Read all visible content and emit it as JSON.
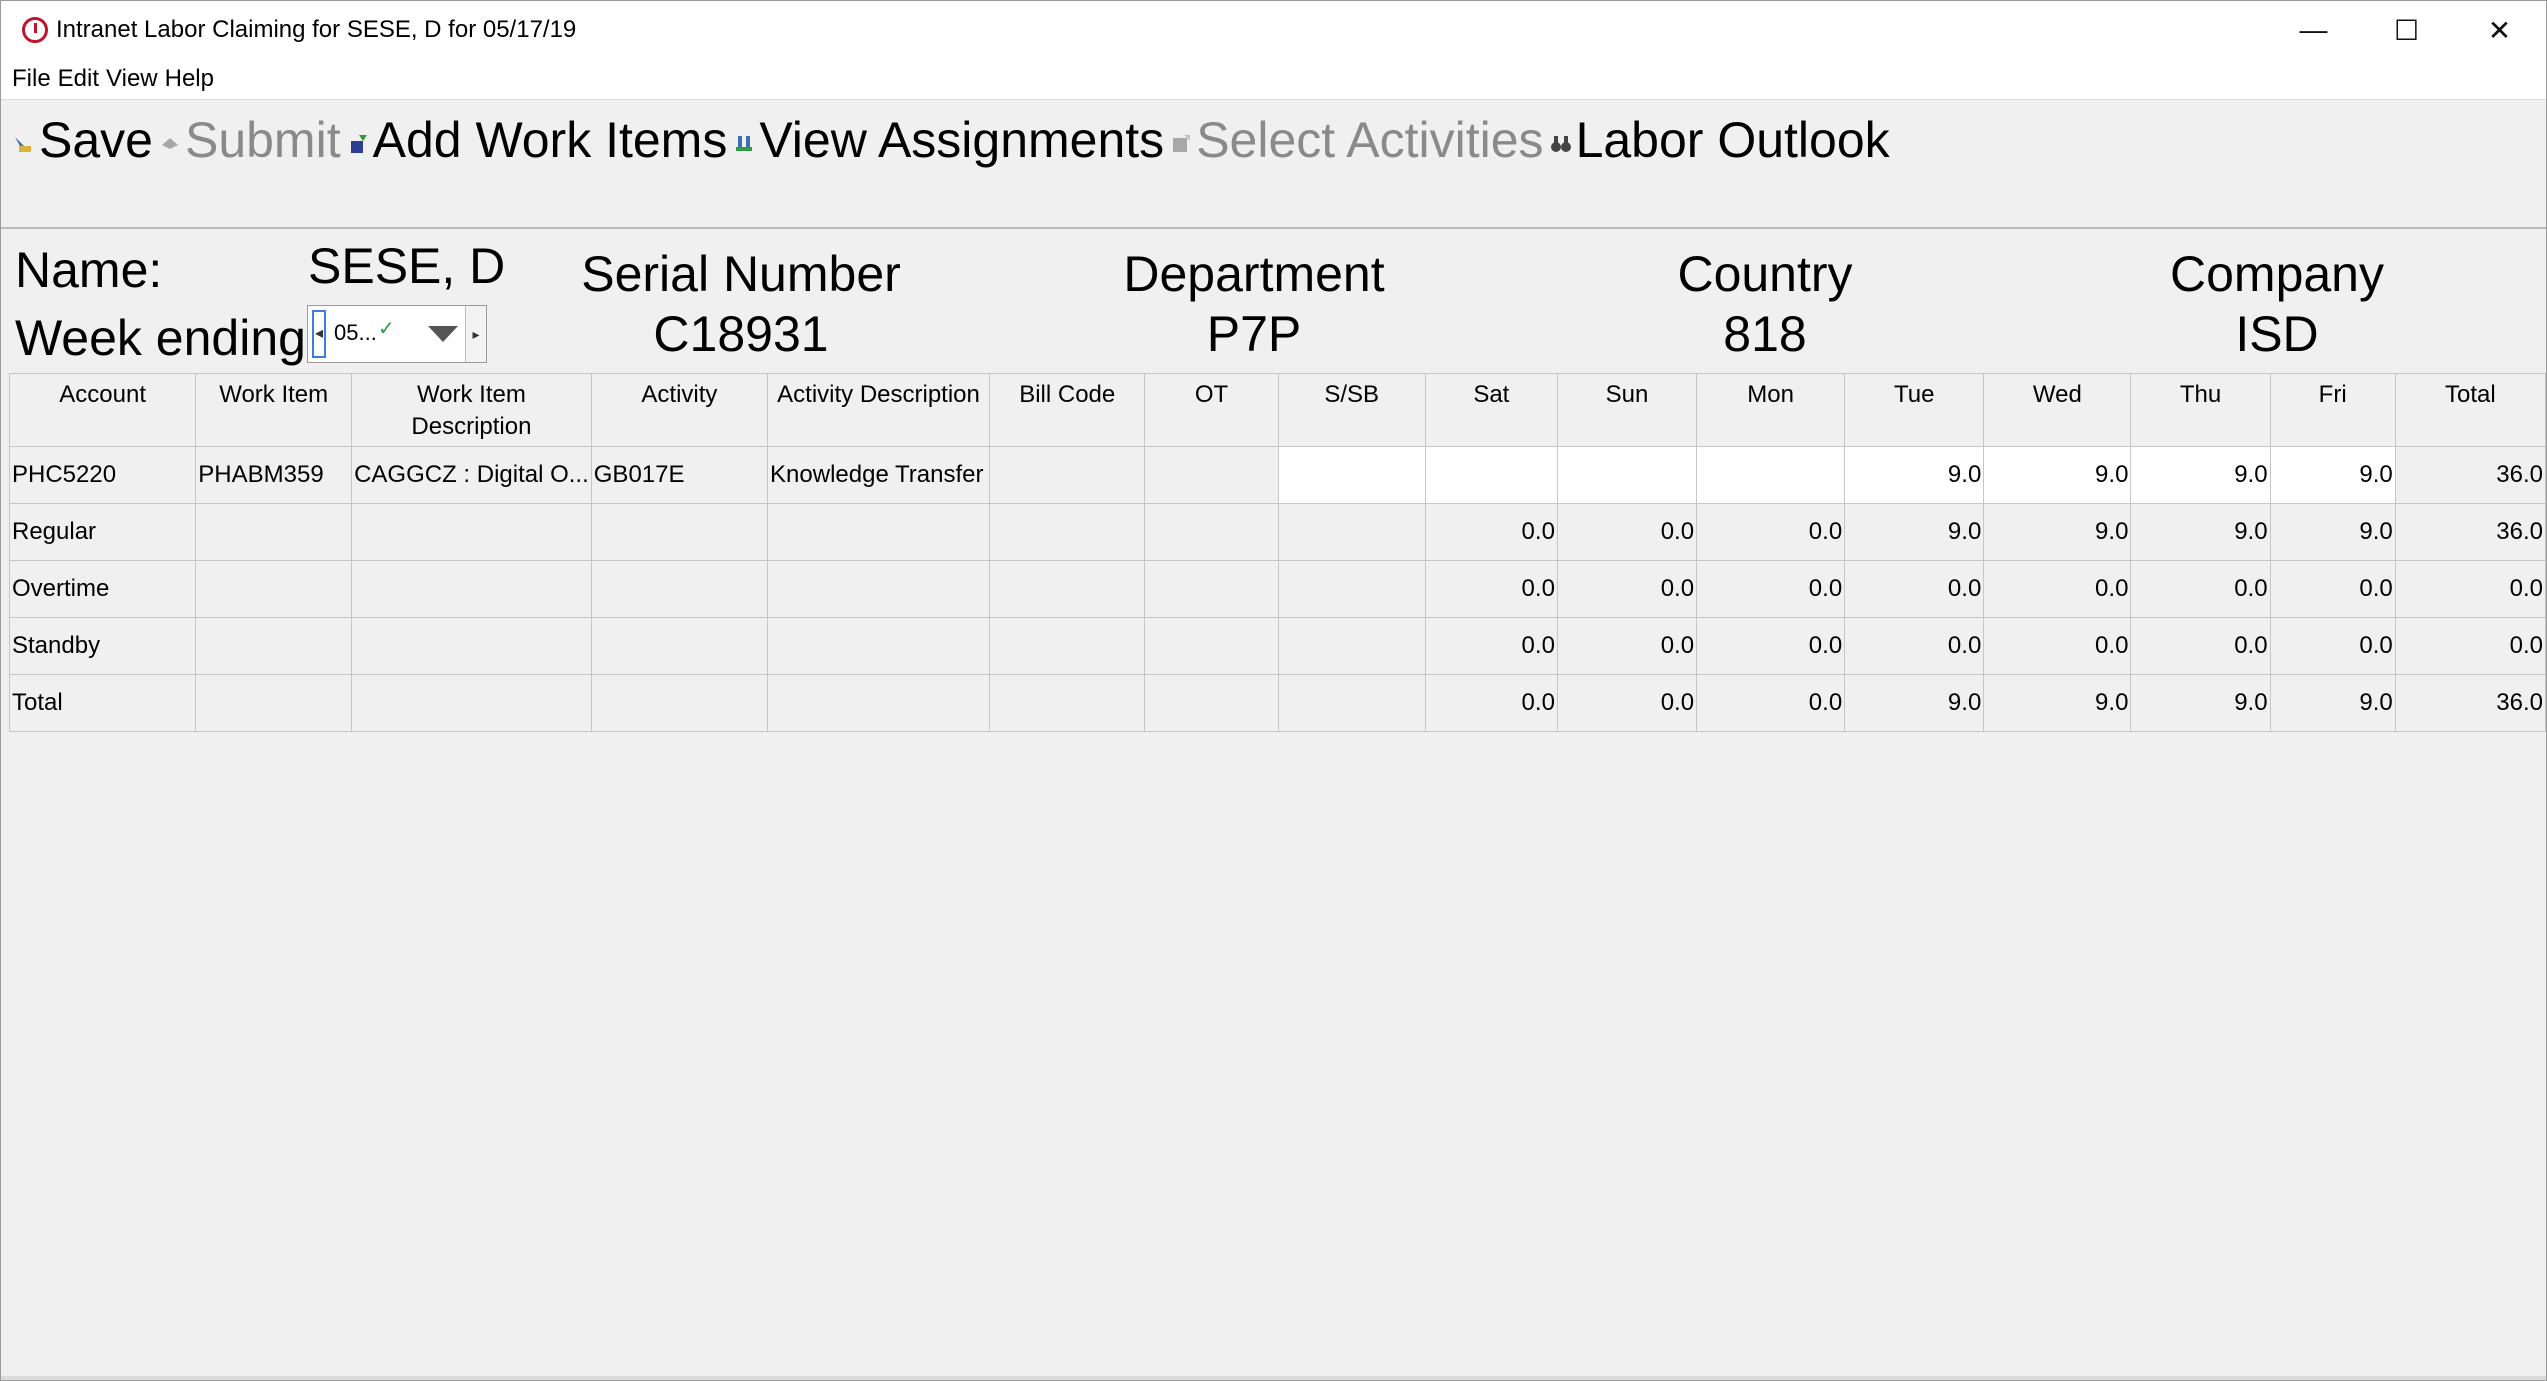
{
  "window": {
    "title": "Intranet Labor Claiming for SESE, D for 05/17/19",
    "controls": {
      "minimize": "—",
      "maximize": "☐",
      "close": "✕"
    }
  },
  "menu": {
    "items": [
      "File",
      "Edit",
      "View",
      "Help"
    ]
  },
  "toolbar": {
    "buttons": [
      {
        "label": "Save",
        "enabled": true,
        "icon": "save-icon"
      },
      {
        "label": "Submit",
        "enabled": false,
        "icon": "submit-icon"
      },
      {
        "label": "Add Work Items",
        "enabled": true,
        "icon": "add-icon"
      },
      {
        "label": "View Assignments",
        "enabled": true,
        "icon": "assignments-icon"
      },
      {
        "label": "Select Activities",
        "enabled": false,
        "icon": "activities-icon"
      },
      {
        "label": "Labor Outlook",
        "enabled": true,
        "icon": "binoculars-icon"
      }
    ]
  },
  "header": {
    "name_label": "Name:",
    "name_value": "SESE, D",
    "week_label": "Week ending:",
    "week_value": "05...",
    "serial_label": "Serial Number",
    "serial_value": "C18931",
    "department_label": "Department",
    "department_value": "P7P",
    "country_label": "Country",
    "country_value": "818",
    "company_label": "Company",
    "company_value": "ISD"
  },
  "grid": {
    "columns": [
      "Account",
      "Work Item",
      "Work Item Description",
      "Activity",
      "Activity Description",
      "Bill Code",
      "OT",
      "S/SB",
      "Sat",
      "Sun",
      "Mon",
      "Tue",
      "Wed",
      "Thu",
      "Fri",
      "Total"
    ],
    "rows": [
      [
        "PHC5220",
        "PHABM359",
        "CAGGCZ : Digital O...",
        "GB017E",
        "Knowledge Transfer",
        "",
        "",
        "",
        "",
        "",
        "",
        "9.0",
        "9.0",
        "9.0",
        "9.0",
        "36.0"
      ],
      [
        "Regular",
        "",
        "",
        "",
        "",
        "",
        "",
        "",
        "0.0",
        "0.0",
        "0.0",
        "9.0",
        "9.0",
        "9.0",
        "9.0",
        "36.0"
      ],
      [
        "Overtime",
        "",
        "",
        "",
        "",
        "",
        "",
        "",
        "0.0",
        "0.0",
        "0.0",
        "0.0",
        "0.0",
        "0.0",
        "0.0",
        "0.0"
      ],
      [
        "Standby",
        "",
        "",
        "",
        "",
        "",
        "",
        "",
        "0.0",
        "0.0",
        "0.0",
        "0.0",
        "0.0",
        "0.0",
        "0.0",
        "0.0"
      ],
      [
        "Total",
        "",
        "",
        "",
        "",
        "",
        "",
        "",
        "0.0",
        "0.0",
        "0.0",
        "9.0",
        "9.0",
        "9.0",
        "9.0",
        "36.0"
      ]
    ]
  }
}
